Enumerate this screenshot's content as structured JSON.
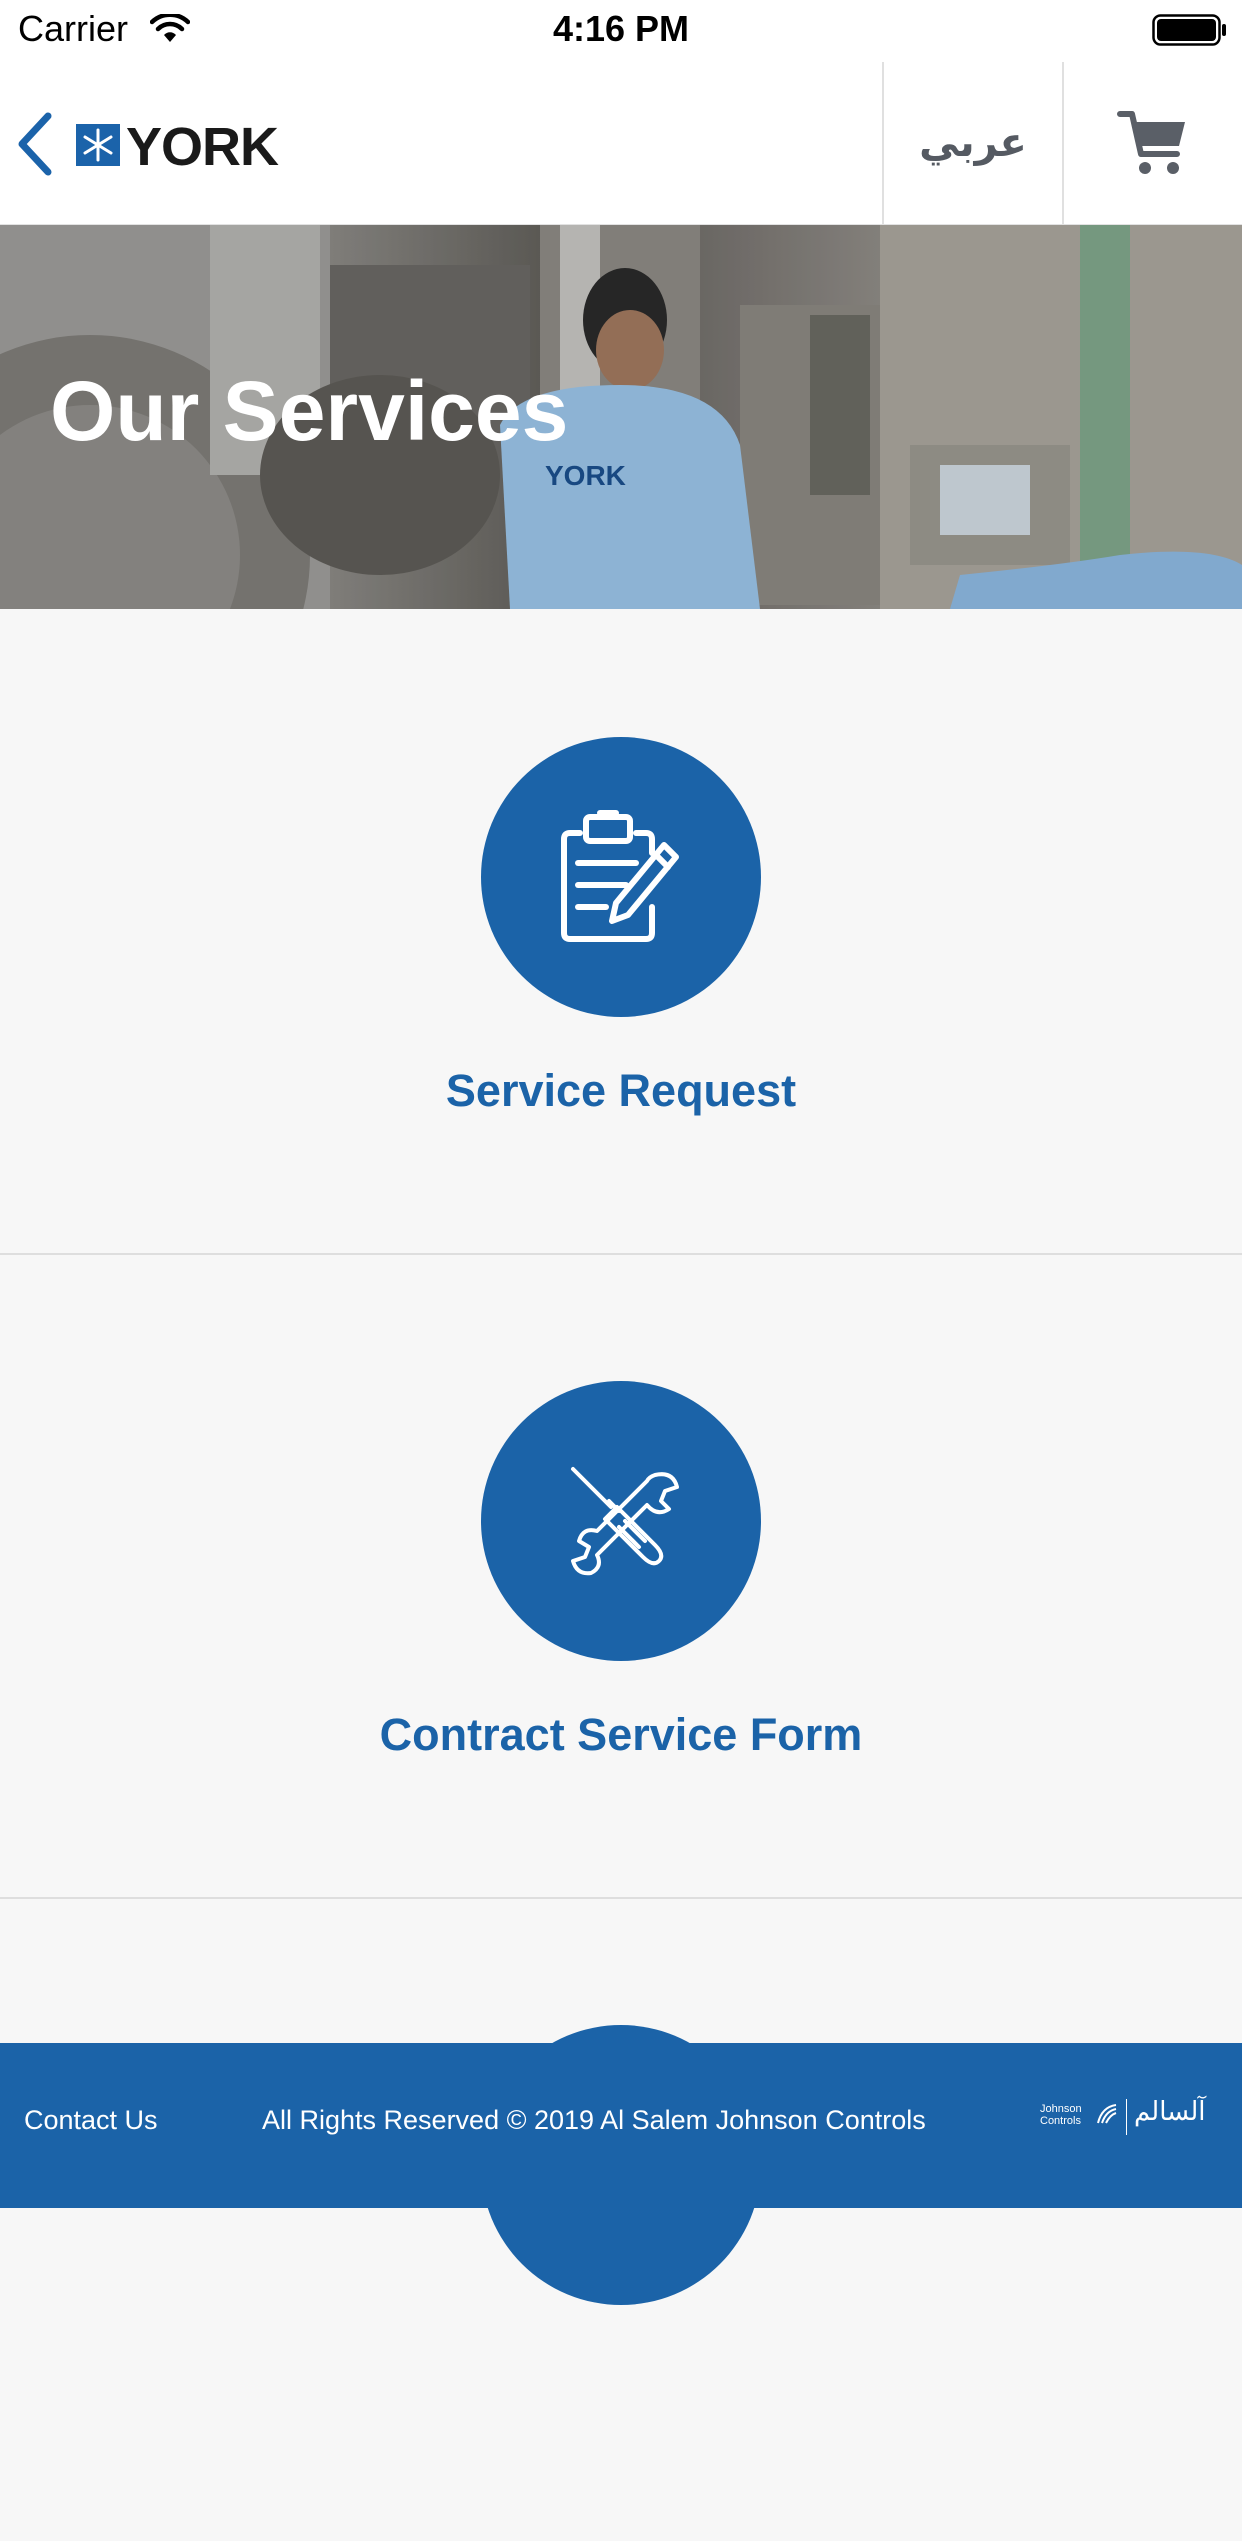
{
  "status_bar": {
    "carrier": "Carrier",
    "time": "4:16 PM"
  },
  "header": {
    "logo_text": "YORK",
    "language_label": "عربي"
  },
  "hero": {
    "title": "Our Services",
    "shirt_text": "YORK"
  },
  "services": [
    {
      "label": "Service Request",
      "icon": "clipboard-edit-icon"
    },
    {
      "label": "Contract Service Form",
      "icon": "tools-icon"
    }
  ],
  "footer": {
    "contact_label": "Contact Us",
    "rights_text": "All Rights Reserved © 2019 Al Salem Johnson Controls",
    "jc_logo_line1": "Johnson",
    "jc_logo_line2": "Controls",
    "alsalem_logo": "آلسالم"
  },
  "colors": {
    "brand_blue": "#1b63a8",
    "header_bg": "#ffffff",
    "page_bg": "#f7f7f7"
  }
}
